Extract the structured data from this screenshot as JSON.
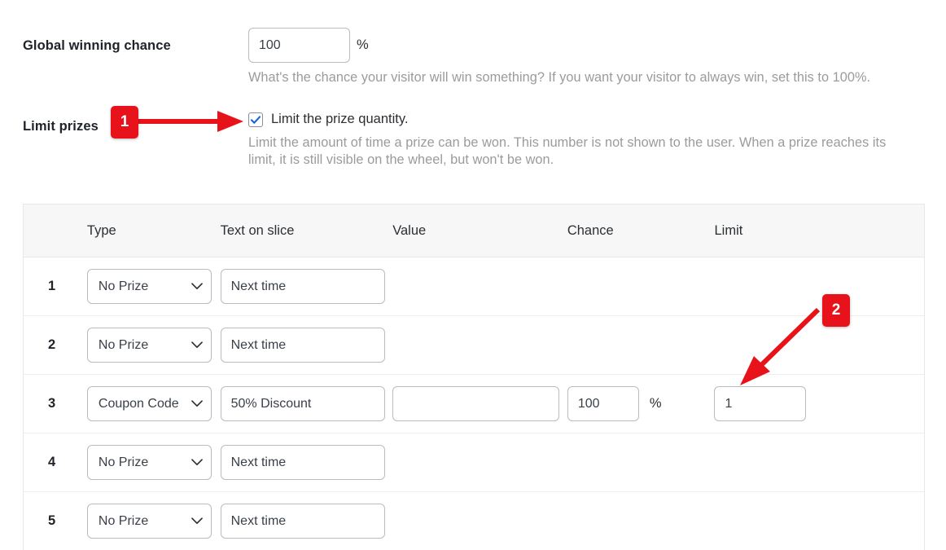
{
  "form": {
    "global_chance": {
      "label": "Global winning chance",
      "value": "100",
      "placeholder": "",
      "unit": "%",
      "help": "What's the chance your visitor will win something? If you want your visitor to always win, set this to 100%."
    },
    "limit_prizes": {
      "label": "Limit prizes",
      "checkbox_label": "Limit the prize quantity.",
      "checked": true,
      "help": "Limit the amount of time a prize can be won. This number is not shown to the user. When a prize reaches its limit, it is still visible on the wheel, but won't be won."
    }
  },
  "table": {
    "headers": [
      "",
      "Type",
      "Text on slice",
      "Value",
      "Chance",
      "Limit"
    ],
    "rows": [
      {
        "index": "1",
        "type": "No Prize",
        "text_on_slice": "Next time",
        "value": null,
        "chance": null,
        "chance_unit": "",
        "limit": null
      },
      {
        "index": "2",
        "type": "No Prize",
        "text_on_slice": "Next time",
        "value": null,
        "chance": null,
        "chance_unit": "",
        "limit": null
      },
      {
        "index": "3",
        "type": "Coupon Code",
        "text_on_slice": "50% Discount",
        "value": "",
        "chance": "100",
        "chance_unit": "%",
        "limit": "1"
      },
      {
        "index": "4",
        "type": "No Prize",
        "text_on_slice": "Next time",
        "value": null,
        "chance": null,
        "chance_unit": "",
        "limit": null
      },
      {
        "index": "5",
        "type": "No Prize",
        "text_on_slice": "Next time",
        "value": null,
        "chance": null,
        "chance_unit": "",
        "limit": null
      }
    ]
  },
  "annotations": {
    "color": "#e8131a",
    "badges": [
      {
        "label": "1",
        "points_to": "limit-prize-quantity-checkbox"
      },
      {
        "label": "2",
        "points_to": "row-3-limit-input"
      }
    ]
  },
  "icons": {
    "checkmark": "check-icon",
    "chevron": "chevron-down-icon"
  }
}
